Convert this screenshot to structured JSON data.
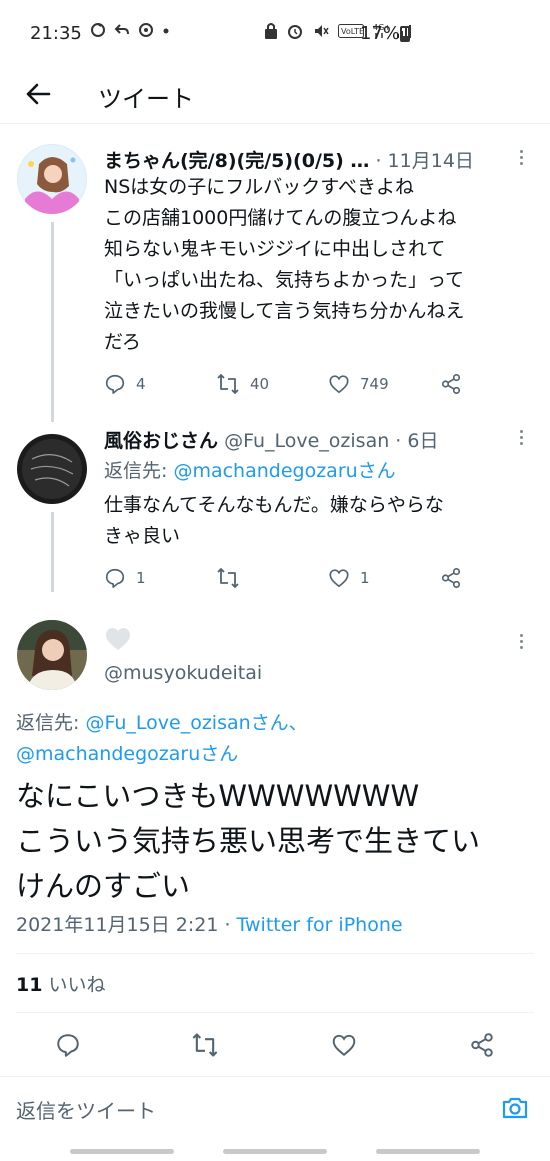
{
  "status_bar": {
    "time": "21:35",
    "battery": "17%",
    "icons_left": [
      "sync-icon",
      "reply-icon",
      "location-icon",
      "dot-icon"
    ],
    "icons_right": [
      "lock-icon",
      "alarm-icon",
      "mute-icon",
      "volte-icon",
      "4g-icon",
      "signal-icon"
    ]
  },
  "header": {
    "title": "ツイート"
  },
  "tweets": [
    {
      "name": "まちゃん(完/8)(完/5)(0/5) …",
      "meta": "· 11月14日",
      "lines": [
        "NSは女の子にフルバックすべきよね",
        "この店舗1000円儲けてんの腹立つんよね",
        "知らない鬼キモいジジイに中出しされて",
        "「いっぱい出たね、気持ちよかった」って",
        "泣きたいの我慢して言う気持ち分かんねえ",
        "だろ"
      ],
      "replies": "4",
      "retweets": "40",
      "likes": "749"
    },
    {
      "name": "風俗おじさん",
      "meta": "@Fu_Love_ozisan · 6日",
      "reply_prefix": "返信先: ",
      "reply_handle": "@machandegozaruさん",
      "lines": [
        "仕事なんてそんなもんだ。嫌ならやらな",
        "きゃ良い"
      ],
      "replies": "1",
      "retweets": "",
      "likes": "1"
    }
  ],
  "main_tweet": {
    "handle": "@musyokudeitai",
    "reply_prefix": "返信先: ",
    "reply_handle_1": "@Fu_Love_ozisanさん、",
    "reply_handle_2": "@machandegozaruさん",
    "lines": [
      "なにこいつきもWWWWWWW",
      "こういう気持ち悪い思考で生きてい",
      "けんのすごい"
    ],
    "timestamp": "2021年11月15日 2:21 · ",
    "via": "Twitter for iPhone",
    "like_count": "11",
    "like_label": " いいね"
  },
  "reply_bar": {
    "placeholder": "返信をツイート"
  },
  "colors": {
    "accent": "#1d9bf0",
    "secondary_text": "#536471",
    "primary_text": "#0f1419",
    "divider": "#eff3f4"
  }
}
